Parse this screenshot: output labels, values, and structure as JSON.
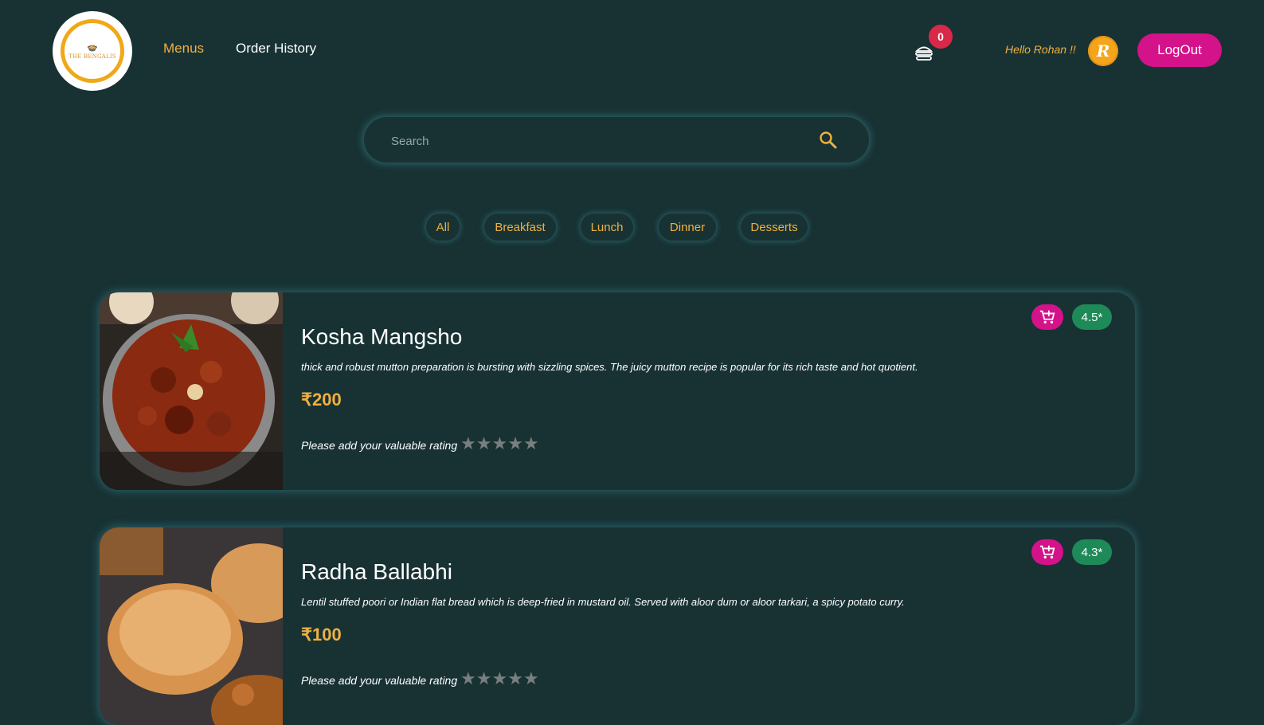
{
  "header": {
    "logo_text": "THE BENGALIS",
    "nav": [
      {
        "label": "Menus",
        "active": true
      },
      {
        "label": "Order History",
        "active": false
      }
    ],
    "cart_count": "0",
    "greeting": "Hello Rohan !!",
    "avatar_letter": "R",
    "logout_label": "LogOut"
  },
  "search": {
    "placeholder": "Search",
    "value": ""
  },
  "filters": [
    "All",
    "Breakfast",
    "Lunch",
    "Dinner",
    "Desserts"
  ],
  "items": [
    {
      "name": "Kosha Mangsho",
      "description": "thick and robust mutton preparation is bursting with sizzling spices. The juicy mutton recipe is popular for its rich taste and hot quotient.",
      "price": "₹200",
      "rating": "4.5*",
      "rating_prompt": "Please add your valuable rating",
      "stars": [
        "★",
        "★",
        "★",
        "★",
        "★"
      ]
    },
    {
      "name": "Radha Ballabhi",
      "description": "Lentil stuffed poori or Indian flat bread which is deep-fried in mustard oil. Served with aloor dum or aloor tarkari, a spicy potato curry.",
      "price": "₹100",
      "rating": "4.3*",
      "rating_prompt": "Please add your valuable rating",
      "stars": [
        "★",
        "★",
        "★",
        "★",
        "★"
      ]
    }
  ],
  "colors": {
    "background": "#183234",
    "accent": "#f0b040",
    "primary_button": "#d4128a",
    "rating_badge": "#1e8a58",
    "cart_badge": "#d8294a"
  },
  "icons": [
    "logo",
    "burger-cart-icon",
    "search-icon",
    "add-to-cart-icon",
    "star-icon"
  ]
}
